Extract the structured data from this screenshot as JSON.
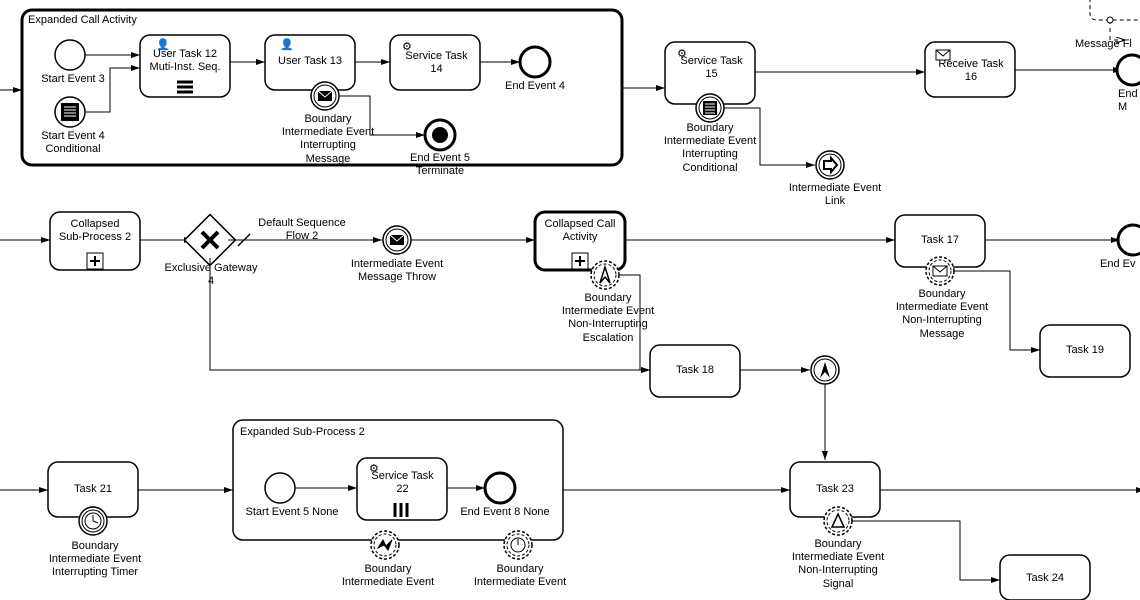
{
  "chart_data": {
    "type": "bpmn",
    "elements": [
      {
        "id": "expandedCall",
        "type": "subprocess",
        "label": "Expanded Call Activity"
      },
      {
        "id": "start3",
        "type": "startEvent",
        "label": "Start Event 3"
      },
      {
        "id": "start4",
        "type": "startEventConditional",
        "label": "Start Event 4 Conditional"
      },
      {
        "id": "ut12",
        "type": "userTask",
        "label": "User Task 12 Muti-Inst. Seq."
      },
      {
        "id": "ut13",
        "type": "userTask",
        "label": "User Task 13"
      },
      {
        "id": "bMsg",
        "type": "boundaryMessageInterrupting",
        "label": "Boundary Intermediate Event Interrupting Message"
      },
      {
        "id": "st14",
        "type": "serviceTask",
        "label": "Service Task 14"
      },
      {
        "id": "end4",
        "type": "endEvent",
        "label": "End Event 4"
      },
      {
        "id": "end5",
        "type": "terminateEvent",
        "label": "End Event 5 Terminate"
      },
      {
        "id": "st15",
        "type": "serviceTask",
        "label": "Service Task 15"
      },
      {
        "id": "bCond",
        "type": "boundaryConditionalInterrupting",
        "label": "Boundary Intermediate Event Interrupting Conditional"
      },
      {
        "id": "linkCatch",
        "type": "intermediateLink",
        "label": "Intermediate Event Link"
      },
      {
        "id": "rt16",
        "type": "receiveTask",
        "label": "Receive Task 16"
      },
      {
        "id": "msgFlow",
        "type": "messageFlow",
        "label": "Message Flow"
      },
      {
        "id": "endM",
        "type": "endEvent",
        "label": "End M"
      },
      {
        "id": "csp2",
        "type": "collapsedSubprocess",
        "label": "Collapsed Sub-Process 2"
      },
      {
        "id": "xor4",
        "type": "exclusiveGateway",
        "label": "Exclusive Gateway 4"
      },
      {
        "id": "defFlow",
        "type": "sequenceFlow",
        "label": "Default Sequence Flow 2"
      },
      {
        "id": "msgThrow",
        "type": "intermediateMessageThrow",
        "label": "Intermediate Event Message Throw"
      },
      {
        "id": "cca",
        "type": "collapsedCallActivity",
        "label": "Collapsed Call Activity"
      },
      {
        "id": "bEsc",
        "type": "boundaryEscalationNonInterrupting",
        "label": "Boundary Intermediate Event Non-Interrupting Escalation"
      },
      {
        "id": "t17",
        "type": "task",
        "label": "Task 17"
      },
      {
        "id": "bMsgNI",
        "type": "boundaryMessageNonInterrupting",
        "label": "Boundary Intermediate Event Non-Interrupting Message"
      },
      {
        "id": "endEv",
        "type": "endEvent",
        "label": "End Ev"
      },
      {
        "id": "t18",
        "type": "task",
        "label": "Task 18"
      },
      {
        "id": "escThrow",
        "type": "intermediateEscalationThrow",
        "label": ""
      },
      {
        "id": "t19",
        "type": "task",
        "label": "Task 19"
      },
      {
        "id": "t21",
        "type": "task",
        "label": "Task 21"
      },
      {
        "id": "bTimer",
        "type": "boundaryTimerInterrupting",
        "label": "Boundary Intermediate Event Interrupting Timer"
      },
      {
        "id": "esp2",
        "type": "subprocess",
        "label": "Expanded Sub-Process 2"
      },
      {
        "id": "start5",
        "type": "startEvent",
        "label": "Start Event 5 None"
      },
      {
        "id": "st22",
        "type": "serviceTaskMulti",
        "label": "Service Task 22"
      },
      {
        "id": "end8",
        "type": "endEvent",
        "label": "End Event 8 None"
      },
      {
        "id": "bNI1",
        "type": "boundaryNonInterrupting",
        "label": "Boundary Intermediate Event"
      },
      {
        "id": "bNI2",
        "type": "boundaryNonInterrupting",
        "label": "Boundary Intermediate Event"
      },
      {
        "id": "t23",
        "type": "task",
        "label": "Task 23"
      },
      {
        "id": "bSig",
        "type": "boundarySignalNonInterrupting",
        "label": "Boundary Intermediate Event Non-Interrupting Signal"
      },
      {
        "id": "t24",
        "type": "task",
        "label": "Task 24"
      }
    ]
  },
  "labels": {
    "expandedCall": "Expanded Call Activity",
    "start3": "Start Event 3",
    "start4": "Start Event 4\nConditional",
    "ut12": "User Task 12\nMuti-Inst. Seq.",
    "ut13": "User Task 13",
    "bMsg": "Boundary\nIntermediate Event\nInterrupting\nMessage",
    "st14": "Service Task\n14",
    "end4": "End Event 4",
    "end5": "End Event 5\nTerminate",
    "st15": "Service Task\n15",
    "bCond": "Boundary\nIntermediate Event\nInterrupting\nConditional",
    "link": "Intermediate Event\nLink",
    "rt16": "Receive Task\n16",
    "msgFlow": "Message Fl",
    "endM": "End\nM",
    "csp2": "Collapsed\nSub-Process 2",
    "xor4": "Exclusive Gateway\n4",
    "defFlow": "Default Sequence\nFlow 2",
    "msgThrow": "Intermediate Event\nMessage Throw",
    "cca": "Collapsed Call\nActivity",
    "bEsc": "Boundary\nIntermediate Event\nNon-Interrupting\nEscalation",
    "t17": "Task 17",
    "bMsgNI": "Boundary\nIntermediate Event\nNon-Interrupting\nMessage",
    "endEv": "End Ev",
    "t18": "Task 18",
    "t19": "Task 19",
    "t21": "Task 21",
    "bTimer": "Boundary\nIntermediate Event\nInterrupting Timer",
    "esp2": "Expanded Sub-Process 2",
    "start5": "Start Event 5 None",
    "st22": "Service Task\n22",
    "end8": "End Event 8 None",
    "bie1": "Boundary\nIntermediate Event",
    "bie2": "Boundary\nIntermediate Event",
    "t23": "Task 23",
    "bSig": "Boundary\nIntermediate Event\nNon-Interrupting\nSignal",
    "t24": "Task 24"
  }
}
